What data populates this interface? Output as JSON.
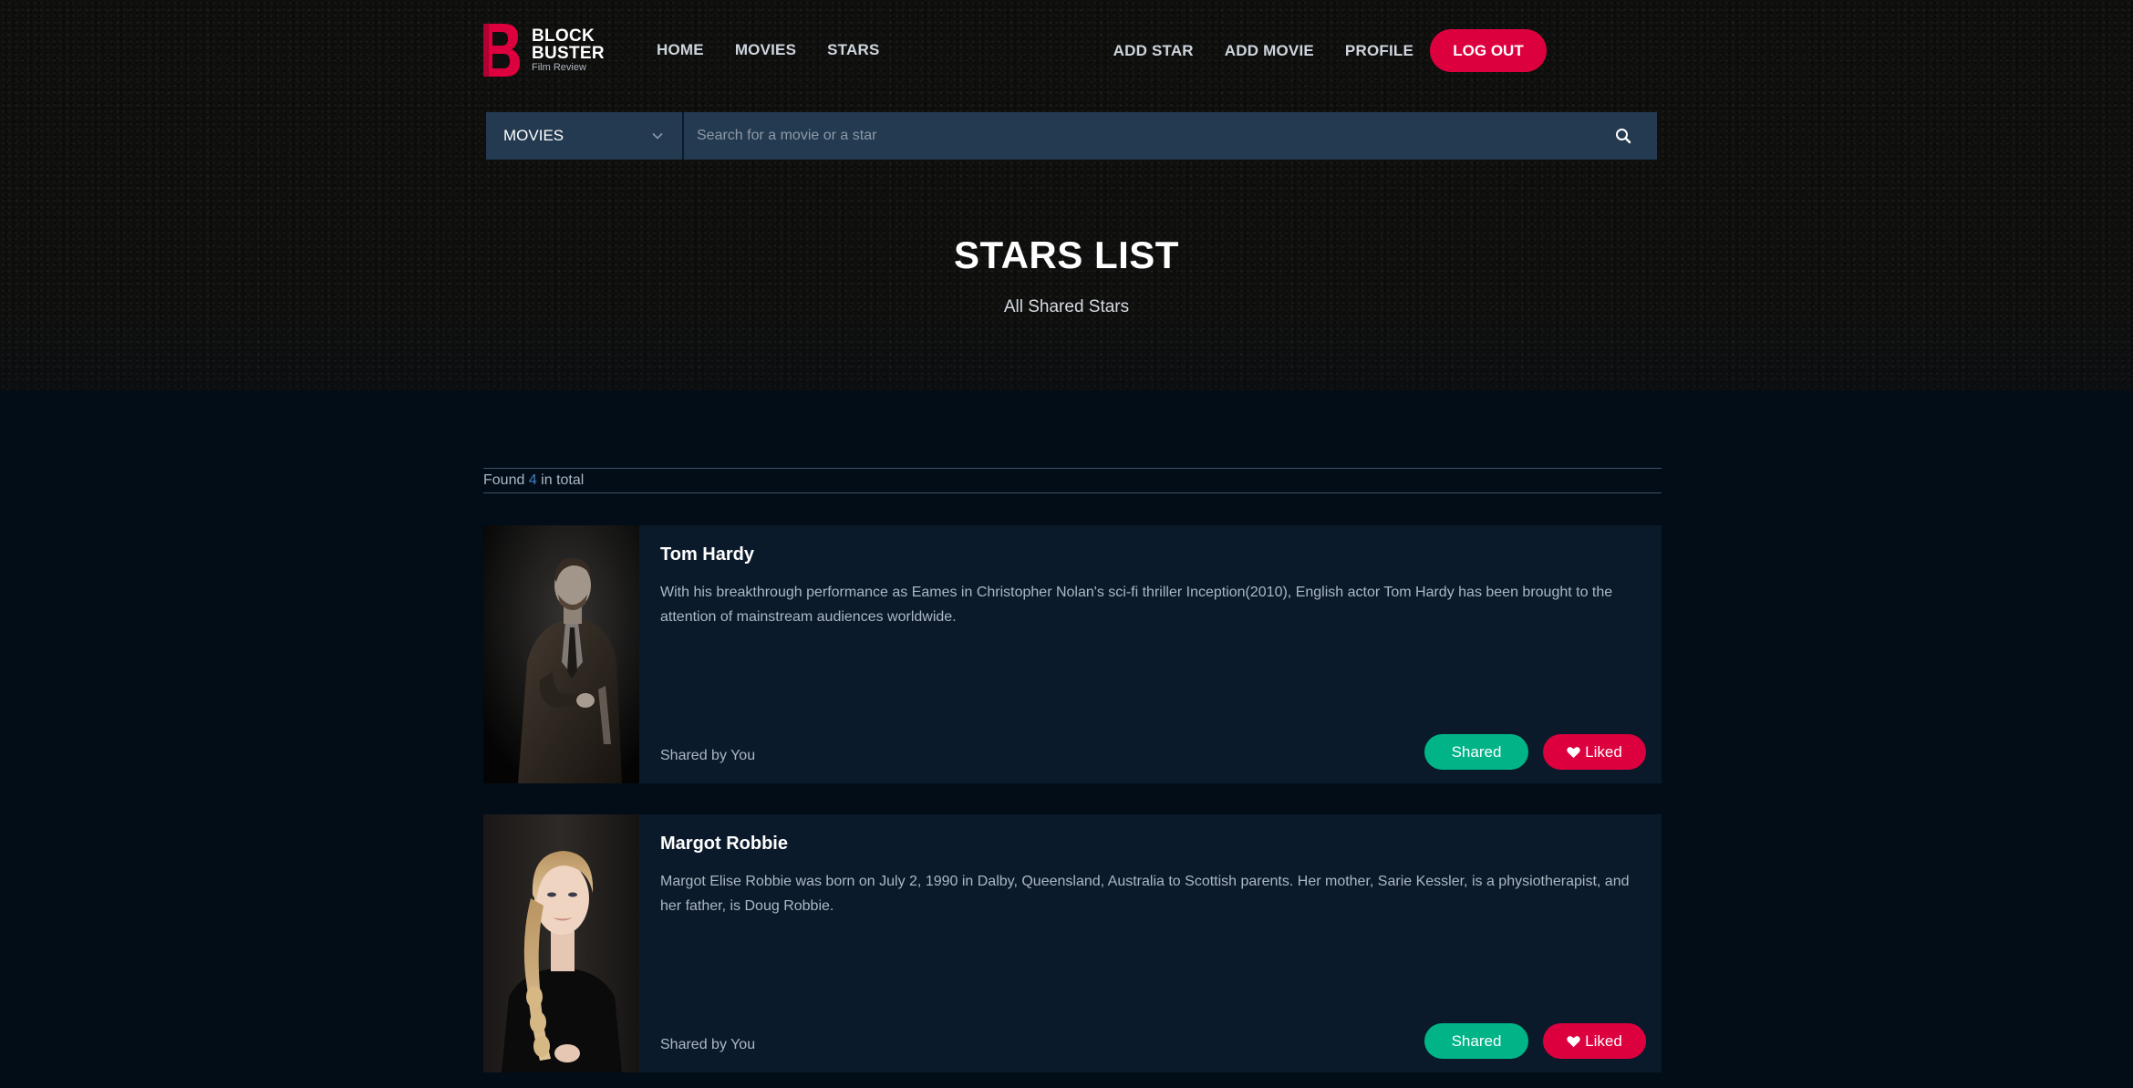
{
  "logo": {
    "line1": "BLOCK",
    "line2": "BUSTER",
    "tagline": "Film Review",
    "brand_color": "#dd003f"
  },
  "nav": {
    "left": [
      {
        "label": "HOME"
      },
      {
        "label": "MOVIES"
      },
      {
        "label": "STARS"
      }
    ],
    "right": [
      {
        "label": "ADD STAR"
      },
      {
        "label": "ADD MOVIE"
      },
      {
        "label": "PROFILE"
      }
    ],
    "logout_label": "LOG OUT"
  },
  "search": {
    "category": "MOVIES",
    "placeholder": "Search for a movie or a star",
    "icon": "search-icon"
  },
  "hero": {
    "title": "STARS LIST",
    "subtitle": "All Shared Stars"
  },
  "results": {
    "prefix": "Found ",
    "count": "4",
    "suffix": " in total"
  },
  "stars": [
    {
      "name": "Tom Hardy",
      "bio": "With his breakthrough performance as Eames in Christopher Nolan's sci-fi thriller Inception(2010), English actor Tom Hardy has been brought to the attention of mainstream audiences worldwide.",
      "shared_by": "Shared by You",
      "shared_label": "Shared",
      "liked_label": "Liked"
    },
    {
      "name": "Margot Robbie",
      "bio": "Margot Elise Robbie was born on July 2, 1990 in Dalby, Queensland, Australia to Scottish parents. Her mother, Sarie Kessler, is a physiotherapist, and her father, is Doug Robbie.",
      "shared_by": "Shared by You",
      "shared_label": "Shared",
      "liked_label": "Liked"
    }
  ],
  "colors": {
    "accent": "#dd003f",
    "shared": "#00b488",
    "card_bg": "#0b1a2a",
    "page_bg": "#020d18",
    "search_bg": "#233a50"
  }
}
